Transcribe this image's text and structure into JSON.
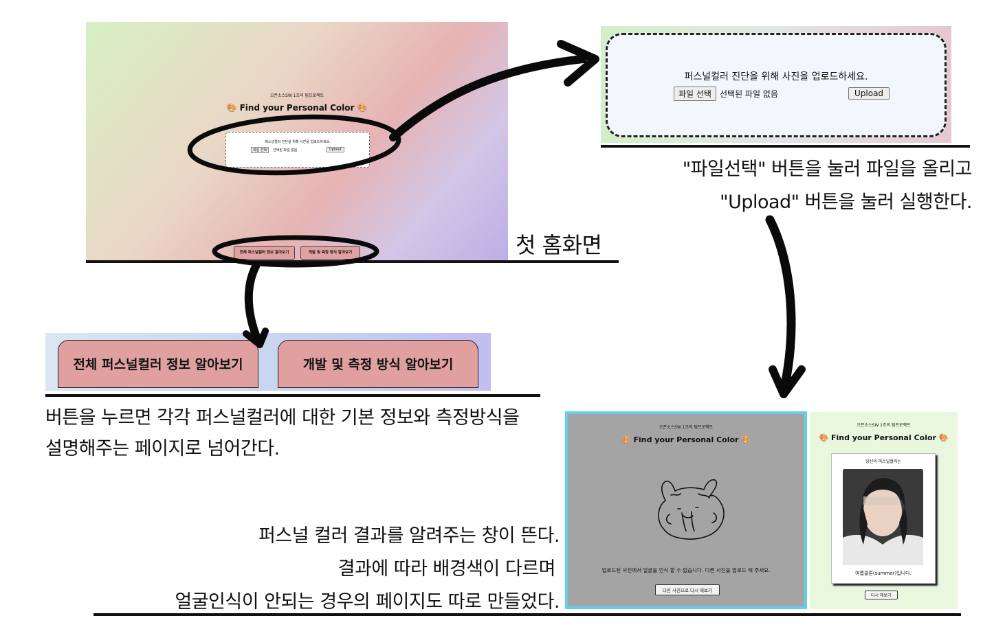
{
  "home": {
    "team": "오픈소스SW 1조의 팀프로젝트",
    "title": "🎨 Find your Personal Color 🎨",
    "upload_prompt": "퍼스널컬러 진단을 위해 사진을 업로드하세요.",
    "file_button": "파일 선택",
    "file_status": "선택된 파일 없음",
    "upload_button": "Upload",
    "btn_info": "전체 퍼스널컬러 정보 알아보기",
    "btn_dev": "개발 및 측정 방식 알아보기",
    "caption": "첫 홈화면"
  },
  "upload": {
    "prompt": "퍼스널컬러 진단을 위해 사진을 업로드하세요.",
    "file_button": "파일 선택",
    "file_status": "선택된 파일 없음",
    "upload_button": "Upload",
    "caption_line1": "\"파일선택\" 버튼을 눌러 파일을 올리고",
    "caption_line2": "\"Upload\" 버튼을 눌러 실행한다."
  },
  "buttons": {
    "btn_info": "전체 퍼스널컬러 정보 알아보기",
    "btn_dev": "개발 및 측정 방식 알아보기",
    "caption_line1": "버튼을 누르면 각각 퍼스널컬러에 대한 기본 정보와 측정방식을",
    "caption_line2": "설명해주는 페이지로 넘어간다."
  },
  "result": {
    "fail": {
      "team": "오픈소스SW 1조의 팀프로젝트",
      "title": "🎨 Find your Personal Color 🎨",
      "message": "업로드된 사진에서 얼굴을 인식 할 수 없습니다. 다른 사진을 업로드 해 주세요.",
      "retry": "다른 사진으로 다시 해보기"
    },
    "success": {
      "team": "오픈소스SW 1조의 팀프로젝트",
      "title": "🎨 Find your Personal Color 🎨",
      "label": "당신의 퍼스널컬러는",
      "result": "여름쿨톤(summer)입니다.",
      "retry": "다시 해보기"
    },
    "caption_line1": "퍼스널 컬러 결과를 알려주는 창이 뜬다.",
    "caption_line2": "결과에 따라 배경색이 다르며",
    "caption_line3": "얼굴인식이 안되는 경우의 페이지도 따로 만들었다."
  }
}
